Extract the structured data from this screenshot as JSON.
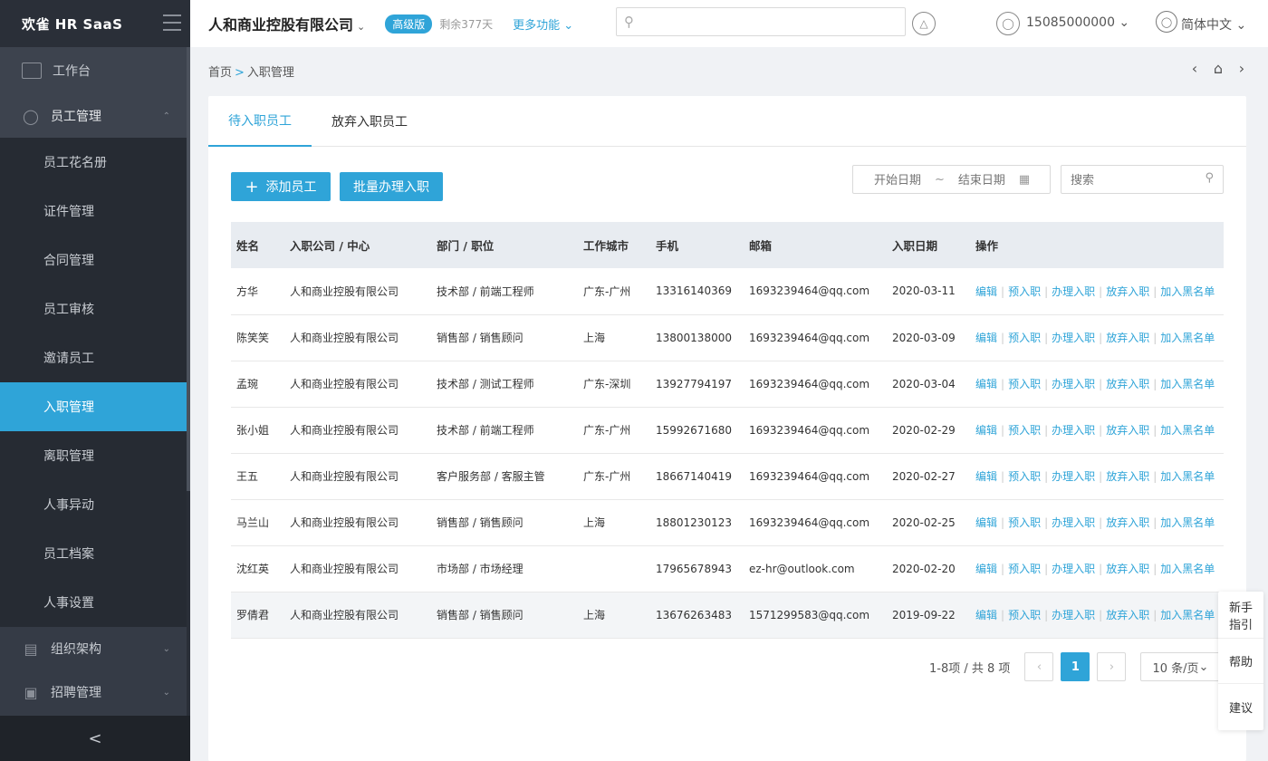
{
  "app": {
    "logo": "欢雀 HR SaaS"
  },
  "sidebar": {
    "workbench": "工作台",
    "group_employee": "员工管理",
    "items": [
      "员工花名册",
      "证件管理",
      "合同管理",
      "员工审核",
      "邀请员工",
      "入职管理",
      "离职管理",
      "人事异动",
      "员工档案",
      "人事设置"
    ],
    "group_org": "组织架构",
    "group_recruit": "招聘管理",
    "collapse": "<"
  },
  "header": {
    "company": "人和商业控股有限公司",
    "badge": "高级版",
    "remain": "剩余377天",
    "more": "更多功能",
    "search_placeholder": "",
    "phone": "15085000000",
    "language": "简体中文"
  },
  "breadcrumb": {
    "home": "首页",
    "current": "入职管理"
  },
  "tabs": [
    "待入职员工",
    "放弃入职员工"
  ],
  "toolbar": {
    "add": "添加员工",
    "batch": "批量办理入职",
    "start_placeholder": "开始日期",
    "end_placeholder": "结束日期",
    "search_placeholder": "搜索"
  },
  "table": {
    "columns": [
      "姓名",
      "入职公司 / 中心",
      "部门 / 职位",
      "工作城市",
      "手机",
      "邮箱",
      "入职日期",
      "操作"
    ],
    "rows": [
      [
        "方华",
        "人和商业控股有限公司",
        "技术部 / 前端工程师",
        "广东-广州",
        "13316140369",
        "1693239464@qq.com",
        "2020-03-11"
      ],
      [
        "陈笑笑",
        "人和商业控股有限公司",
        "销售部 / 销售顾问",
        "上海",
        "13800138000",
        "1693239464@qq.com",
        "2020-03-09"
      ],
      [
        "孟琬",
        "人和商业控股有限公司",
        "技术部 / 测试工程师",
        "广东-深圳",
        "13927794197",
        "1693239464@qq.com",
        "2020-03-04"
      ],
      [
        "张小姐",
        "人和商业控股有限公司",
        "技术部 / 前端工程师",
        "广东-广州",
        "15992671680",
        "1693239464@qq.com",
        "2020-02-29"
      ],
      [
        "王五",
        "人和商业控股有限公司",
        "客户服务部 / 客服主管",
        "广东-广州",
        "18667140419",
        "1693239464@qq.com",
        "2020-02-27"
      ],
      [
        "马兰山",
        "人和商业控股有限公司",
        "销售部 / 销售顾问",
        "上海",
        "18801230123",
        "1693239464@qq.com",
        "2020-02-25"
      ],
      [
        "沈红英",
        "人和商业控股有限公司",
        "市场部 / 市场经理",
        "",
        "17965678943",
        "ez-hr@outlook.com",
        "2020-02-20"
      ],
      [
        "罗倩君",
        "人和商业控股有限公司",
        "销售部 / 销售顾问",
        "上海",
        "13676263483",
        "1571299583@qq.com",
        "2019-09-22"
      ]
    ],
    "actions": [
      "编辑",
      "预入职",
      "办理入职",
      "放弃入职",
      "加入黑名单"
    ]
  },
  "pagination": {
    "summary": "1-8项 / 共 8 项",
    "current": "1",
    "page_size": "10 条/页"
  },
  "float_panel": {
    "guide": "新手指引",
    "help": "帮助",
    "suggest": "建议"
  }
}
